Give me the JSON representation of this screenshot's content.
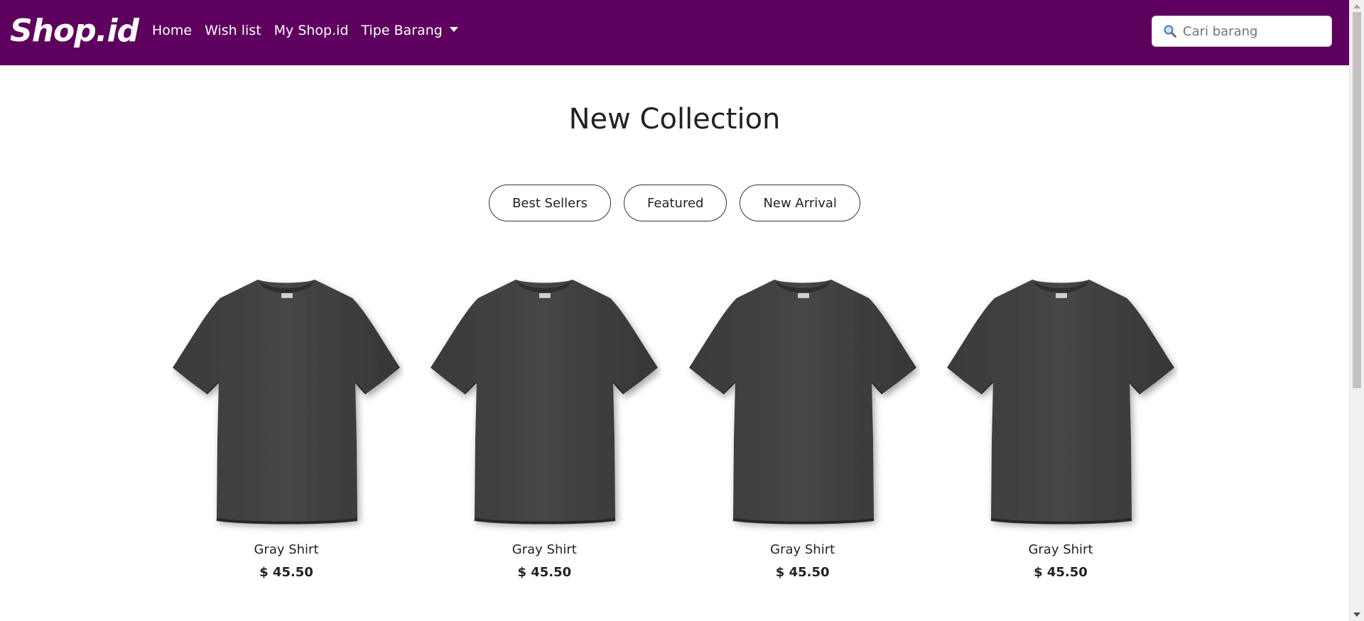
{
  "navbar": {
    "brand": "Shop.id",
    "links": [
      {
        "label": "Home"
      },
      {
        "label": "Wish list"
      },
      {
        "label": "My Shop.id"
      },
      {
        "label": "Tipe Barang"
      }
    ],
    "search": {
      "icon": "search-icon",
      "placeholder": "Cari barang",
      "value": ""
    },
    "background_color": "#5e005e"
  },
  "main": {
    "title": "New Collection",
    "filters": [
      {
        "label": "Best Sellers"
      },
      {
        "label": "Featured"
      },
      {
        "label": "New Arrival"
      }
    ],
    "products": [
      {
        "name": "Gray Shirt",
        "price": "$ 45.50",
        "image": "gray-tshirt-image"
      },
      {
        "name": "Gray Shirt",
        "price": "$ 45.50",
        "image": "gray-tshirt-image"
      },
      {
        "name": "Gray Shirt",
        "price": "$ 45.50",
        "image": "gray-tshirt-image"
      },
      {
        "name": "Gray Shirt",
        "price": "$ 45.50",
        "image": "gray-tshirt-image"
      }
    ]
  }
}
